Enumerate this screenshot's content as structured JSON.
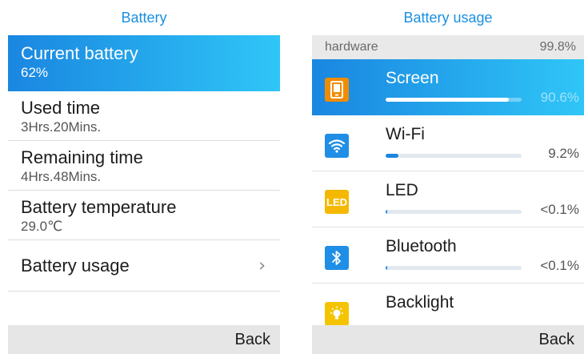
{
  "left_screen": {
    "title": "Battery",
    "items": [
      {
        "label": "Current battery",
        "value": "62%"
      },
      {
        "label": "Used time",
        "value": "3Hrs.20Mins."
      },
      {
        "label": "Remaining time",
        "value": "4Hrs.48Mins."
      },
      {
        "label": "Battery temperature",
        "value": "29.0℃"
      },
      {
        "label": "Battery usage",
        "value": ""
      }
    ],
    "chevron": "›",
    "softkey": "Back"
  },
  "right_screen": {
    "title": "Battery usage",
    "section": {
      "label": "hardware",
      "value": "99.8%"
    },
    "items": [
      {
        "name": "Screen",
        "percent": "90.6%",
        "fraction": 0.906,
        "icon": "phone-screen-icon"
      },
      {
        "name": "Wi-Fi",
        "percent": "9.2%",
        "fraction": 0.092,
        "icon": "wifi-icon"
      },
      {
        "name": "LED",
        "percent": "<0.1%",
        "fraction": 0.001,
        "icon": "led-icon",
        "icon_text": "LED"
      },
      {
        "name": "Bluetooth",
        "percent": "<0.1%",
        "fraction": 0.001,
        "icon": "bluetooth-icon"
      },
      {
        "name": "Backlight",
        "percent": "",
        "fraction": 0,
        "icon": "lightbulb-icon"
      }
    ],
    "softkey": "Back"
  },
  "colors": {
    "accent": "#1a86e0",
    "accent_light": "#2fc6f7",
    "title_blue": "#1a8fe0",
    "softkey_bg": "#e6e6e6",
    "header_bg": "#e9e9e9",
    "screen_icon": "#f08c00",
    "led_icon": "#f5b800"
  }
}
